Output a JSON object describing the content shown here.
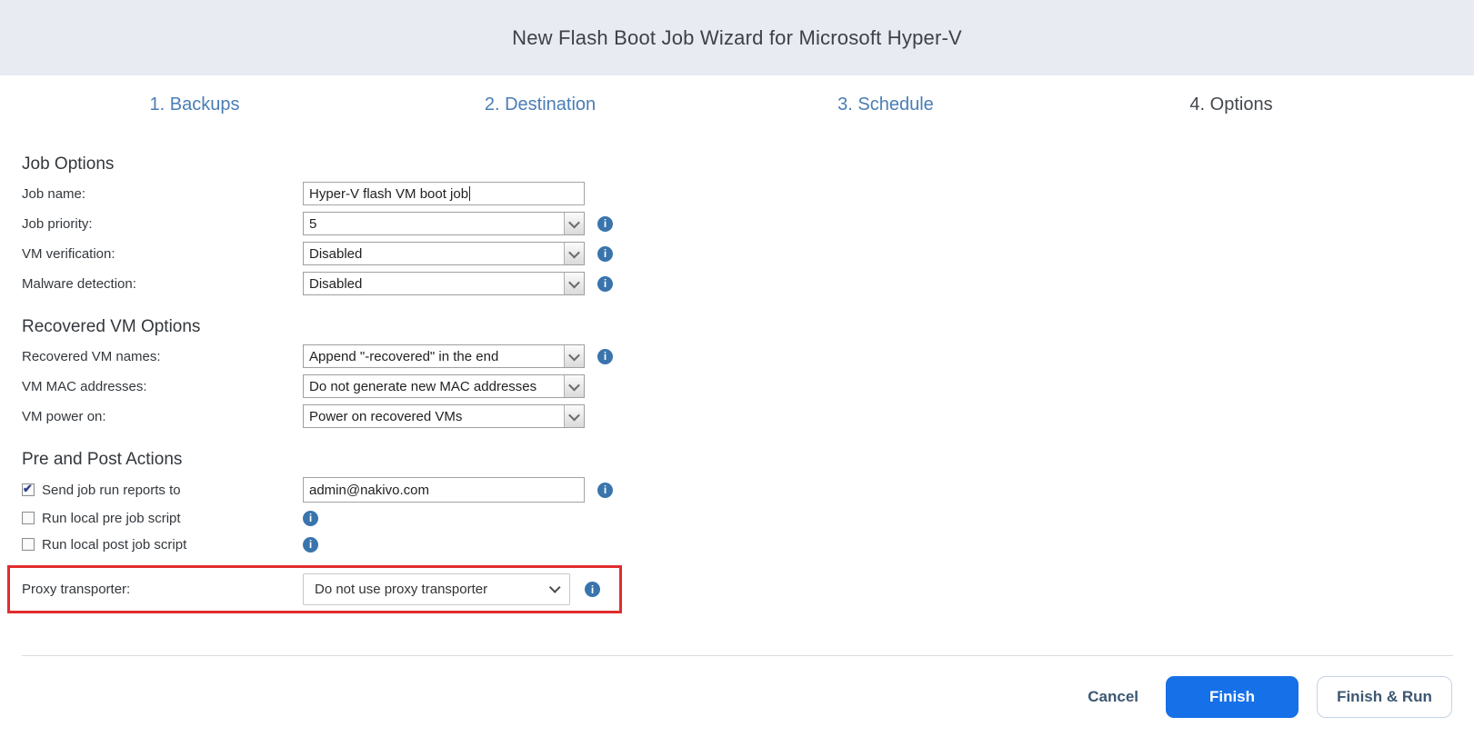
{
  "header": {
    "title": "New Flash Boot Job Wizard for Microsoft Hyper-V"
  },
  "steps": [
    {
      "label": "1. Backups",
      "active": false
    },
    {
      "label": "2. Destination",
      "active": false
    },
    {
      "label": "3. Schedule",
      "active": false
    },
    {
      "label": "4. Options",
      "active": true
    }
  ],
  "sections": {
    "job_options": {
      "heading": "Job Options",
      "job_name": {
        "label": "Job name:",
        "value": "Hyper-V flash VM boot job"
      },
      "job_priority": {
        "label": "Job priority:",
        "value": "5"
      },
      "vm_verification": {
        "label": "VM verification:",
        "value": "Disabled"
      },
      "malware_detection": {
        "label": "Malware detection:",
        "value": "Disabled"
      }
    },
    "recovered": {
      "heading": "Recovered VM Options",
      "vm_names": {
        "label": "Recovered VM names:",
        "value": "Append \"-recovered\" in the end"
      },
      "mac": {
        "label": "VM MAC addresses:",
        "value": "Do not generate new MAC addresses"
      },
      "power": {
        "label": "VM power on:",
        "value": "Power on recovered VMs"
      }
    },
    "actions": {
      "heading": "Pre and Post Actions",
      "send_reports": {
        "label": "Send job run reports to",
        "checked": true,
        "email": "admin@nakivo.com"
      },
      "pre_script": {
        "label": "Run local pre job script",
        "checked": false
      },
      "post_script": {
        "label": "Run local post job script",
        "checked": false
      }
    },
    "proxy": {
      "label": "Proxy transporter:",
      "value": "Do not use proxy transporter"
    }
  },
  "footer": {
    "cancel": "Cancel",
    "finish": "Finish",
    "finish_run": "Finish & Run"
  },
  "icons": {
    "info": "info-icon",
    "chevron": "chevron-down-icon"
  },
  "colors": {
    "header_bg": "#e8ebf1",
    "step_link_blue": "#4a7db5",
    "step_active": "#43484e",
    "info_icon_blue": "#3a74ad",
    "accent_blue": "#1670e8",
    "highlight_red": "#e12d2d",
    "button_text_slate": "#3d5771"
  }
}
